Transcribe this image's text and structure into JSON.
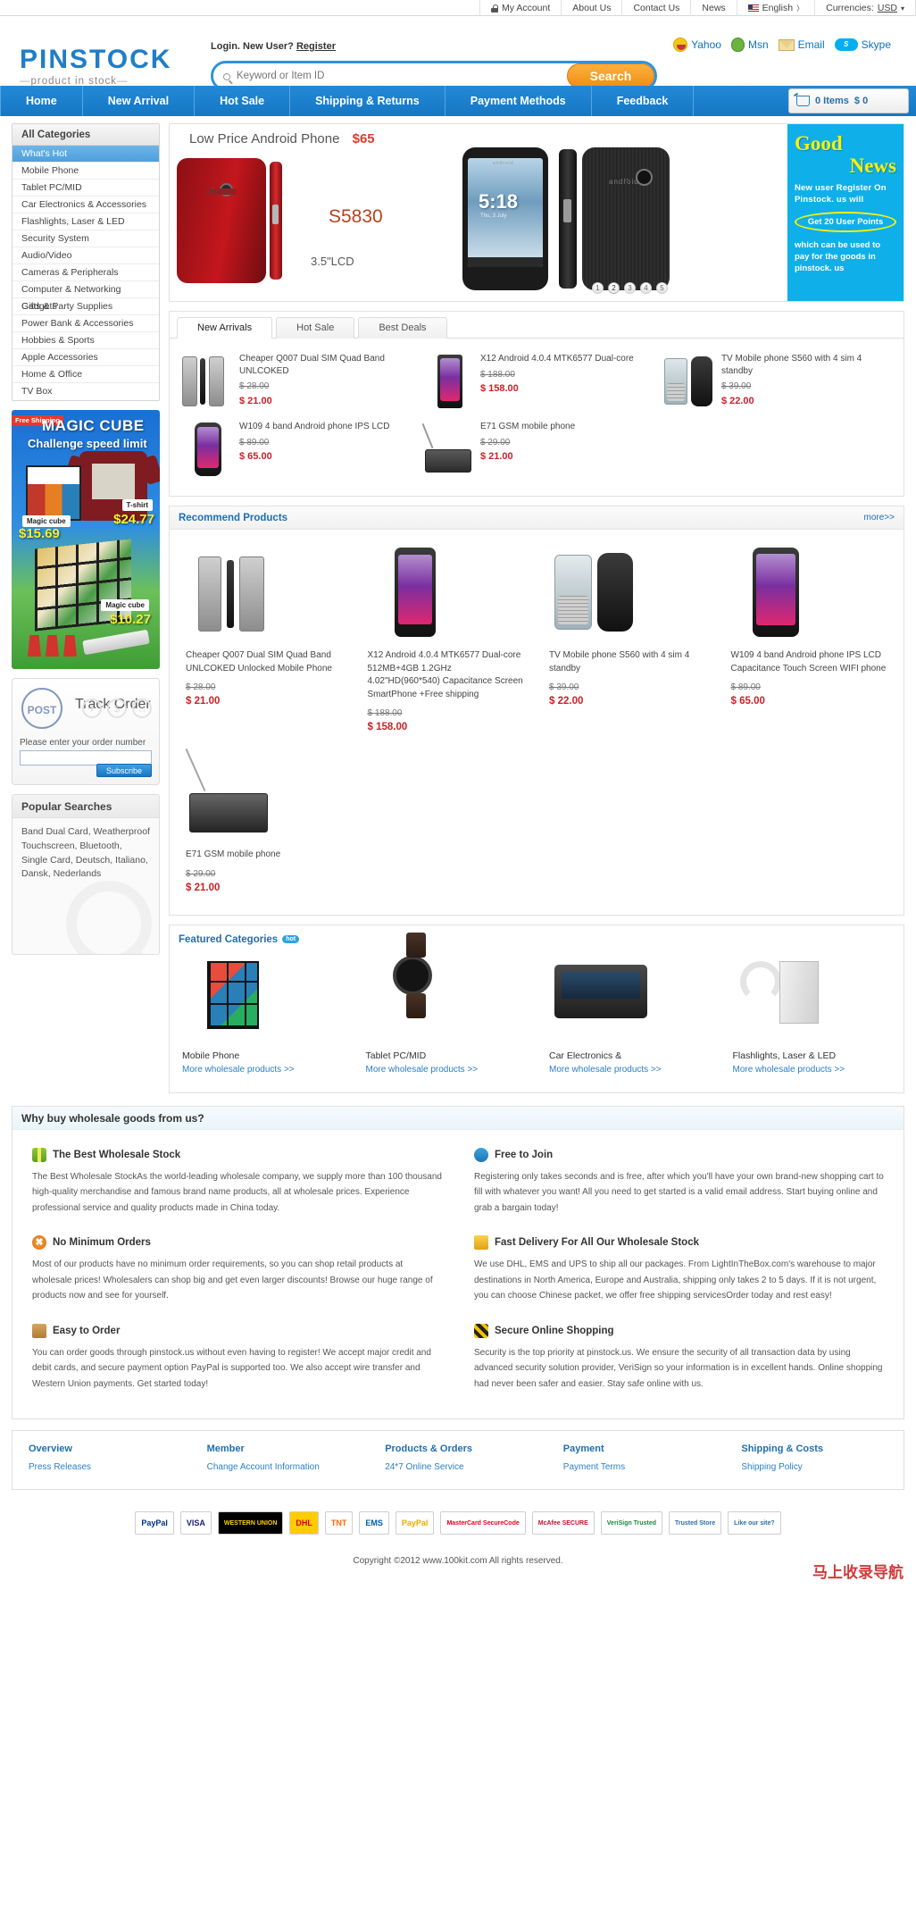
{
  "utility_bar": {
    "items": [
      {
        "label": "My Account",
        "icon": "lock-icon"
      },
      {
        "label": "About Us",
        "icon": ""
      },
      {
        "label": "Contact Us",
        "icon": ""
      },
      {
        "label": "News",
        "icon": ""
      },
      {
        "label": "English",
        "icon": "flag-us-icon"
      },
      {
        "label": "Currencies:",
        "value": "USD",
        "icon": "chevron-down-icon"
      }
    ]
  },
  "header": {
    "logo_word": "PINSTOCK",
    "logo_tagline": "product in stock",
    "login_text": "Login. New User?",
    "register_link": "Register",
    "im_links": [
      {
        "label": "Yahoo",
        "icon": "yahoo-icon"
      },
      {
        "label": "Msn",
        "icon": "msn-icon"
      },
      {
        "label": "Email",
        "icon": "email-icon"
      },
      {
        "label": "Skype",
        "icon": "skype-icon"
      }
    ],
    "search": {
      "placeholder": "Keyword or Item ID",
      "value": "",
      "button_label": "Search"
    }
  },
  "main_nav": {
    "items": [
      "Home",
      "New Arrival",
      "Hot Sale",
      "Shipping & Returns",
      "Payment Methods",
      "Feedback"
    ],
    "cart": {
      "count_label": "0 Items",
      "total_label": "$ 0"
    }
  },
  "sidebar": {
    "categories_title": "All Categories",
    "categories": [
      {
        "label": "What's Hot",
        "active": true
      },
      {
        "label": "Mobile Phone",
        "active": false
      },
      {
        "label": "Tablet PC/MID",
        "active": false
      },
      {
        "label": "Car Electronics & Accessories",
        "active": false
      },
      {
        "label": "Flashlights, Laser & LED",
        "active": false
      },
      {
        "label": "Security System",
        "active": false
      },
      {
        "label": "Audio/Video",
        "active": false
      },
      {
        "label": "Cameras & Peripherals",
        "active": false
      },
      {
        "label": "Computer & Networking Gadgets",
        "active": false
      },
      {
        "label": "Gifts & Party Supplies",
        "active": false
      },
      {
        "label": "Power Bank & Accessories",
        "active": false
      },
      {
        "label": "Hobbies & Sports",
        "active": false
      },
      {
        "label": "Apple Accessories",
        "active": false
      },
      {
        "label": "Home & Office",
        "active": false
      },
      {
        "label": "TV Box",
        "active": false
      }
    ],
    "promo": {
      "free_shipping": "Free Shipping",
      "title": "MAGIC CUBE",
      "subtitle": "Challenge speed limit",
      "tshirt_label": "T-shirt",
      "tshirt_price": "$24.77",
      "cube_label": "Magic cube",
      "cube_price": "$15.69",
      "cube2_label": "Magic cube",
      "cube2_price": "$10.27"
    },
    "track_order": {
      "stamp_text": "POST",
      "title": "Track Order",
      "hint": "Please enter your order number",
      "input_value": "",
      "button_label": "Subscribe"
    },
    "popular_searches": {
      "title": "Popular Searches",
      "body": "Band Dual Card, Weatherproof Touchscreen, Bluetooth, Single Card, Deutsch, Italiano, Dansk, Nederlands"
    }
  },
  "hero": {
    "title": "Low Price Android Phone",
    "price": "$65",
    "model": "S5830",
    "lcd": "3.5\"LCD",
    "phone_screen_time": "5:18",
    "phone_screen_date": "Thu, 3 July",
    "brand_text": "android",
    "slide_dots": [
      "1",
      "2",
      "3",
      "4",
      "5"
    ],
    "active_dot": "2",
    "good_news": {
      "line1": "Good",
      "line2": "News",
      "body1": "New user Register On Pinstock. us will",
      "highlight": "Get 20 User Points",
      "body2": "which can be used to pay for the goods in pinstock. us"
    }
  },
  "tab_panel": {
    "tabs": [
      {
        "label": "New Arrivals",
        "active": true
      },
      {
        "label": "Hot Sale",
        "active": false
      },
      {
        "label": "Best Deals",
        "active": false
      }
    ],
    "products": [
      {
        "name": "Cheaper Q007 Dual SIM Quad Band UNLCOKED",
        "old_price": "$ 28.00",
        "price": "$ 21.00",
        "thumb": "feature-phone-trio"
      },
      {
        "name": "X12 Android 4.0.4 MTK6577 Dual-core",
        "old_price": "$ 188.00",
        "price": "$ 158.00",
        "thumb": "android-smartphone"
      },
      {
        "name": "TV Mobile phone S560 with 4 sim 4 standby",
        "old_price": "$ 39.00",
        "price": "$ 22.00",
        "thumb": "qwerty-phone-pair"
      },
      {
        "name": "W109 4 band Android phone IPS LCD",
        "old_price": "$ 89.00",
        "price": "$ 65.00",
        "thumb": "android-phone-purple"
      },
      {
        "name": "E71 GSM mobile phone",
        "old_price": "$ 29.00",
        "price": "$ 21.00",
        "thumb": "tv-antenna-phone"
      }
    ]
  },
  "recommend": {
    "title": "Recommend Products",
    "more_label": "more>>",
    "products": [
      {
        "name": "Cheaper Q007 Dual SIM Quad Band UNLCOKED Unlocked Mobile Phone",
        "old_price": "$ 28.00",
        "price": "$ 21.00",
        "thumb": "feature-phone-trio"
      },
      {
        "name": "X12 Android 4.0.4 MTK6577 Dual-core 512MB+4GB 1.2GHz 4.02\"HD(960*540) Capacitance Screen SmartPhone +Free shipping",
        "old_price": "$ 188.00",
        "price": "$ 158.00",
        "thumb": "android-smartphone"
      },
      {
        "name": "TV Mobile phone S560 with 4 sim 4 standby",
        "old_price": "$ 39.00",
        "price": "$ 22.00",
        "thumb": "qwerty-phone-pair"
      },
      {
        "name": "W109 4 band Android phone IPS LCD Capacitance Touch Screen WIFI phone",
        "old_price": "$ 89.00",
        "price": "$ 65.00",
        "thumb": "android-phone-purple"
      },
      {
        "name": "E71 GSM mobile phone",
        "old_price": "$ 29.00",
        "price": "$ 21.00",
        "thumb": "tv-antenna-phone"
      }
    ]
  },
  "featured_categories": {
    "title": "Featured Categories",
    "badge": "hot",
    "items": [
      {
        "name": "Mobile Phone",
        "link": "More wholesale products >>",
        "thumb": "rubik-cube"
      },
      {
        "name": "Tablet PC/MID",
        "link": "More wholesale products >>",
        "thumb": "wrist-watch"
      },
      {
        "name": "Car Electronics &",
        "link": "More wholesale products >>",
        "thumb": "car-stereo"
      },
      {
        "name": "Flashlights, Laser & LED",
        "link": "More wholesale products >>",
        "thumb": "headset-pc"
      }
    ]
  },
  "why_buy": {
    "title": "Why buy wholesale goods from us?",
    "items": [
      {
        "icon": "gift-icon",
        "heading": "The Best Wholesale Stock",
        "body": "The Best Wholesale StockAs the world-leading wholesale company, we supply more than 100 thousand high-quality merchandise and famous brand name products, all at wholesale prices. Experience professional service and quality products made in China today."
      },
      {
        "icon": "person-icon",
        "heading": "Free to Join",
        "body": "Registering only takes seconds and is free, after which you'll have your own brand-new shopping cart to fill with whatever you want! All you need to get started is a valid email address. Start buying online and grab a bargain today!"
      },
      {
        "icon": "no-minimum-icon",
        "heading": "No Minimum Orders",
        "body": "Most of our products have no minimum order requirements, so you can shop retail products at wholesale prices! Wholesalers can shop big and get even larger discounts! Browse our huge range of products now and see for yourself."
      },
      {
        "icon": "delivery-cart-icon",
        "heading": "Fast Delivery For All Our Wholesale Stock",
        "body": "We use DHL, EMS and UPS to ship all our packages. From LightInTheBox.com's warehouse to major destinations in North America, Europe and Australia, shipping only takes 2 to 5 days. If it is not urgent, you can choose Chinese packet, we offer free shipping servicesOrder today and rest easy!"
      },
      {
        "icon": "bag-icon",
        "heading": "Easy to Order",
        "body": "You can order goods through pinstock.us without even having to register! We accept major credit and debit cards, and secure payment option PayPal is supported too. We also accept wire transfer and Western Union payments. Get started today!"
      },
      {
        "icon": "secure-icon",
        "heading": "Secure Online Shopping",
        "body": "Security is the top priority at pinstock.us. We ensure the security of all transaction data by using advanced security solution provider, VeriSign so your information is in excellent hands. Online shopping had never been safer and easier. Stay safe online with us."
      }
    ]
  },
  "footer_links": {
    "columns": [
      {
        "heading": "Overview",
        "links": [
          "Press Releases"
        ]
      },
      {
        "heading": "Member",
        "links": [
          "Change Account Information"
        ]
      },
      {
        "heading": "Products & Orders",
        "links": [
          "24*7 Online Service"
        ]
      },
      {
        "heading": "Payment",
        "links": [
          "Payment Terms"
        ]
      },
      {
        "heading": "Shipping & Costs",
        "links": [
          "Shipping Policy"
        ]
      }
    ]
  },
  "payment_badges": [
    "PayPal",
    "VISA",
    "WESTERN UNION",
    "DHL",
    "TNT",
    "EMS",
    "PayPal",
    "MasterCard SecureCode",
    "McAfee SECURE",
    "VeriSign Trusted",
    "Trusted Store",
    "Like our site?"
  ],
  "copyright": "Copyright ©2012 www.100kit.com All rights reserved.",
  "watermark": "马上收录导航"
}
